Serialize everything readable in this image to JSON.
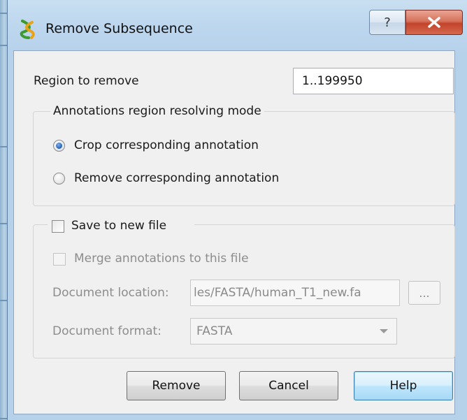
{
  "window": {
    "title": "Remove Subsequence",
    "help_glyph": "?",
    "close_glyph": "X"
  },
  "region": {
    "label": "Region to remove",
    "value": "1..199950"
  },
  "annotations_group": {
    "title": "Annotations region resolving mode",
    "options": [
      {
        "label": "Crop corresponding annotation",
        "checked": true
      },
      {
        "label": "Remove corresponding annotation",
        "checked": false
      }
    ]
  },
  "save_group": {
    "checkbox_label": "Save to new file",
    "checked": false,
    "merge_label": "Merge annotations to this file",
    "location_label": "Document location:",
    "location_value": "les/FASTA/human_T1_new.fa",
    "browse_label": "...",
    "format_label": "Document format:",
    "format_value": "FASTA"
  },
  "buttons": {
    "remove": "Remove",
    "cancel": "Cancel",
    "help": "Help"
  },
  "colors": {
    "close_button": "#c2432a",
    "selected_radio": "#1f5fb8",
    "default_button_border": "#3c7fb1"
  },
  "icons": {
    "app": "ugene-helix-icon",
    "help": "question-mark-icon",
    "close": "close-x-icon",
    "dropdown": "chevron-down-icon"
  }
}
